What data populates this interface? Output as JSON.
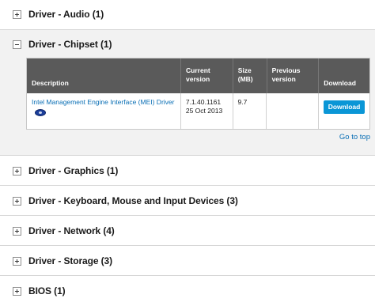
{
  "sections": [
    {
      "title": "Driver - Audio (1)",
      "expanded": false
    },
    {
      "title": "Driver - Chipset (1)",
      "expanded": true
    },
    {
      "title": "Driver - Graphics (1)",
      "expanded": false
    },
    {
      "title": "Driver - Keyboard, Mouse and Input Devices (3)",
      "expanded": false
    },
    {
      "title": "Driver - Network (4)",
      "expanded": false
    },
    {
      "title": "Driver - Storage (3)",
      "expanded": false
    },
    {
      "title": "BIOS (1)",
      "expanded": false
    }
  ],
  "table": {
    "headers": {
      "description": "Description",
      "current_version": "Current version",
      "size": "Size (MB)",
      "previous_version": "Previous version",
      "download": "Download"
    },
    "rows": [
      {
        "description": "Intel Management Engine Interface (MEI) Driver",
        "version": "7.1.40.1161",
        "date": "25 Oct 2013",
        "size": "9.7",
        "previous_version": "",
        "download_label": "Download",
        "icon": "disc-icon"
      }
    ]
  },
  "go_to_top": "Go to top",
  "colors": {
    "header_bg": "#5a5a5a",
    "link": "#0a6fb5",
    "button": "#0a96d6",
    "expanded_bg": "#f2f2f2"
  }
}
